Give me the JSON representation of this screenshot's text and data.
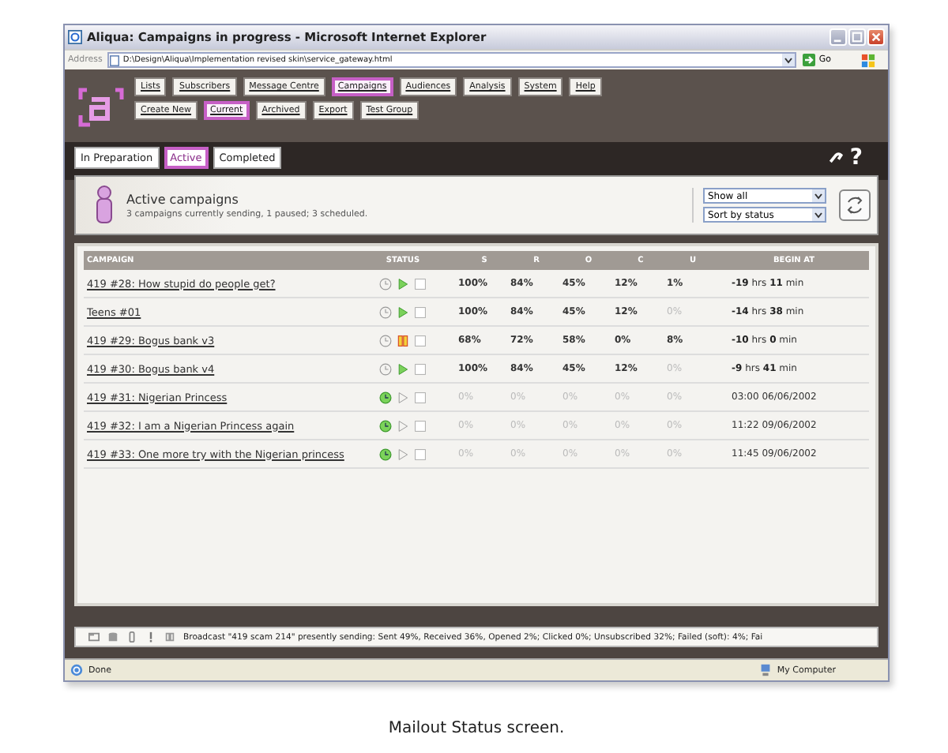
{
  "window": {
    "title": "Aliqua: Campaigns in progress - Microsoft Internet Explorer"
  },
  "address_bar": {
    "label": "Address",
    "url": "D:\\Design\\Aliqua\\Implementation revised skin\\service_gateway.html",
    "go": "Go"
  },
  "main_nav": [
    {
      "label": "Lists",
      "selected": false
    },
    {
      "label": "Subscribers",
      "selected": false
    },
    {
      "label": "Message Centre",
      "selected": false
    },
    {
      "label": "Campaigns",
      "selected": true
    },
    {
      "label": "Audiences",
      "selected": false
    },
    {
      "label": "Analysis",
      "selected": false
    },
    {
      "label": "System",
      "selected": false
    },
    {
      "label": "Help",
      "selected": false
    }
  ],
  "sub_nav": [
    {
      "label": "Create New",
      "selected": false
    },
    {
      "label": "Current",
      "selected": true
    },
    {
      "label": "Archived",
      "selected": false
    },
    {
      "label": "Export",
      "selected": false
    },
    {
      "label": "Test Group",
      "selected": false
    }
  ],
  "tabs": [
    {
      "label": "In Preparation",
      "selected": false
    },
    {
      "label": "Active",
      "selected": true
    },
    {
      "label": "Completed",
      "selected": false
    }
  ],
  "help_mark": "?",
  "header": {
    "title": "Active campaigns",
    "summary": "3 campaigns currently sending, 1 paused; 3 scheduled.",
    "filters": [
      {
        "value": "Show all"
      },
      {
        "value": "Sort by status"
      }
    ]
  },
  "table": {
    "columns": [
      "CAMPAIGN",
      "STATUS",
      "S",
      "R",
      "O",
      "C",
      "U",
      "BEGIN AT"
    ],
    "rows": [
      {
        "campaign": "419 #28: How stupid do people get?",
        "kind": "sending",
        "stats": [
          {
            "value": "100%",
            "muted": false
          },
          {
            "value": "84%",
            "muted": false
          },
          {
            "value": "45%",
            "muted": false
          },
          {
            "value": "12%",
            "muted": false
          },
          {
            "value": "1%",
            "muted": false
          }
        ],
        "begin_at": "**-19** hrs **11** min"
      },
      {
        "campaign": "Teens #01",
        "kind": "sending",
        "stats": [
          {
            "value": "100%",
            "muted": false
          },
          {
            "value": "84%",
            "muted": false
          },
          {
            "value": "45%",
            "muted": false
          },
          {
            "value": "12%",
            "muted": false
          },
          {
            "value": "0%",
            "muted": true
          }
        ],
        "begin_at": "**-14** hrs **38** min"
      },
      {
        "campaign": "419 #29: Bogus bank v3",
        "kind": "paused",
        "stats": [
          {
            "value": "68%",
            "muted": false
          },
          {
            "value": "72%",
            "muted": false
          },
          {
            "value": "58%",
            "muted": false
          },
          {
            "value": "0%",
            "muted": false
          },
          {
            "value": "8%",
            "muted": false
          }
        ],
        "begin_at": "**-10** hrs **0** min"
      },
      {
        "campaign": "419 #30: Bogus bank v4",
        "kind": "sending",
        "stats": [
          {
            "value": "100%",
            "muted": false
          },
          {
            "value": "84%",
            "muted": false
          },
          {
            "value": "45%",
            "muted": false
          },
          {
            "value": "12%",
            "muted": false
          },
          {
            "value": "0%",
            "muted": true
          }
        ],
        "begin_at": "**-9** hrs **41** min"
      },
      {
        "campaign": "419 #31: Nigerian Princess",
        "kind": "scheduled",
        "stats": [
          {
            "value": "0%",
            "muted": true
          },
          {
            "value": "0%",
            "muted": true
          },
          {
            "value": "0%",
            "muted": true
          },
          {
            "value": "0%",
            "muted": true
          },
          {
            "value": "0%",
            "muted": true
          }
        ],
        "begin_at": "03:00 06/06/2002"
      },
      {
        "campaign": "419 #32: I am a Nigerian Princess again",
        "kind": "scheduled",
        "stats": [
          {
            "value": "0%",
            "muted": true
          },
          {
            "value": "0%",
            "muted": true
          },
          {
            "value": "0%",
            "muted": true
          },
          {
            "value": "0%",
            "muted": true
          },
          {
            "value": "0%",
            "muted": true
          }
        ],
        "begin_at": "11:22 09/06/2002"
      },
      {
        "campaign": "419 #33: One more try with the Nigerian princess",
        "kind": "scheduled",
        "stats": [
          {
            "value": "0%",
            "muted": true
          },
          {
            "value": "0%",
            "muted": true
          },
          {
            "value": "0%",
            "muted": true
          },
          {
            "value": "0%",
            "muted": true
          },
          {
            "value": "0%",
            "muted": true
          }
        ],
        "begin_at": "11:45 09/06/2002"
      }
    ]
  },
  "info_bar": {
    "message": "Broadcast \"419 scam 214\" presently sending: Sent 49%, Received 36%, Opened 2%; Clicked 0%; Unsubscribed 32%; Failed (soft): 4%; Fai"
  },
  "status_bar": {
    "text": "Done",
    "zone": "My Computer"
  },
  "caption": "Mailout Status screen."
}
